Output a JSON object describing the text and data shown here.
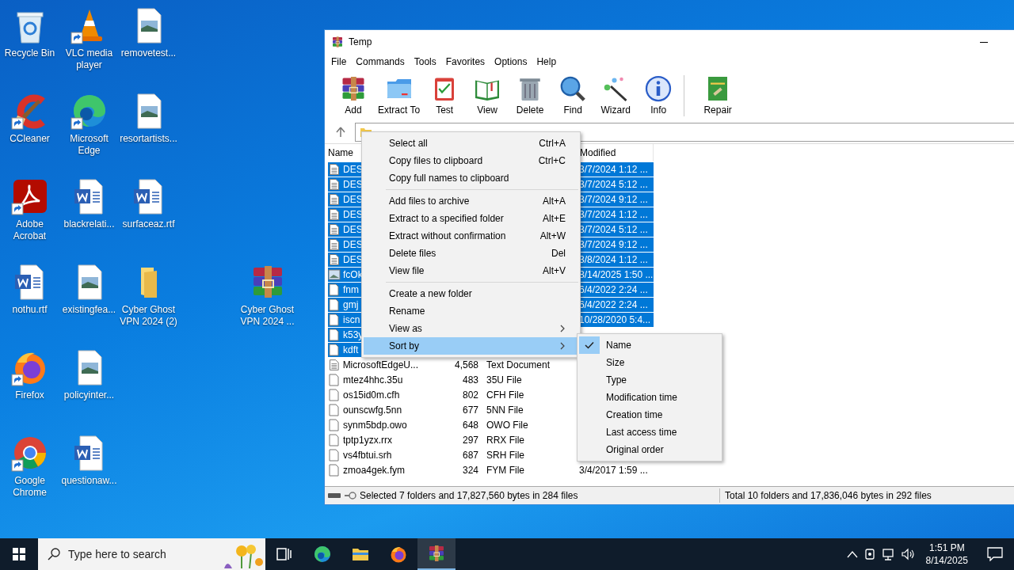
{
  "desktop_icons": [
    {
      "label": "Recycle Bin",
      "kind": "recycle",
      "shortcut": false
    },
    {
      "label": "CCleaner",
      "kind": "ccleaner",
      "shortcut": true
    },
    {
      "label": "Adobe Acrobat",
      "kind": "pdf",
      "shortcut": true
    },
    {
      "label": "nothu.rtf",
      "kind": "word",
      "shortcut": false
    },
    {
      "label": "Firefox",
      "kind": "firefox",
      "shortcut": true
    },
    {
      "label": "Google Chrome",
      "kind": "chrome",
      "shortcut": true
    },
    {
      "label": "VLC media player",
      "kind": "vlc",
      "shortcut": true
    },
    {
      "label": "Microsoft Edge",
      "kind": "edge",
      "shortcut": true
    },
    {
      "label": "blackrelati...",
      "kind": "word",
      "shortcut": false
    },
    {
      "label": "existingfea...",
      "kind": "image",
      "shortcut": false
    },
    {
      "label": "policyinter...",
      "kind": "image",
      "shortcut": false
    },
    {
      "label": "questionaw...",
      "kind": "word",
      "shortcut": false
    },
    {
      "label": "removetest...",
      "kind": "image",
      "shortcut": false
    },
    {
      "label": "resortartists...",
      "kind": "image",
      "shortcut": false
    },
    {
      "label": "surfaceaz.rtf",
      "kind": "word",
      "shortcut": false
    },
    {
      "label": "Cyber Ghost VPN 2024 (2)",
      "kind": "folder",
      "shortcut": false
    },
    {
      "label": "Cyber Ghost VPN 2024 ...",
      "kind": "archive",
      "shortcut": false
    }
  ],
  "window": {
    "title": "Temp",
    "menu": [
      "File",
      "Commands",
      "Tools",
      "Favorites",
      "Options",
      "Help"
    ],
    "toolbar": [
      {
        "label": "Add",
        "kind": "add"
      },
      {
        "label": "Extract To",
        "kind": "extract"
      },
      {
        "label": "Test",
        "kind": "test"
      },
      {
        "label": "View",
        "kind": "view"
      },
      {
        "label": "Delete",
        "kind": "delete"
      },
      {
        "label": "Find",
        "kind": "find"
      },
      {
        "label": "Wizard",
        "kind": "wizard"
      },
      {
        "label": "Info",
        "kind": "info"
      },
      {
        "label": "Repair",
        "kind": "repair"
      }
    ],
    "header": {
      "name": "Name",
      "modified": "Modified"
    },
    "rows": [
      {
        "name": "DES",
        "modified": "3/7/2024 1:12 ...",
        "kind": "text",
        "selected": true
      },
      {
        "name": "DES",
        "modified": "3/7/2024 5:12 ...",
        "kind": "text",
        "selected": true
      },
      {
        "name": "DES",
        "modified": "3/7/2024 9:12 ...",
        "kind": "text",
        "selected": true
      },
      {
        "name": "DES",
        "modified": "3/7/2024 1:12 ...",
        "kind": "text",
        "selected": true
      },
      {
        "name": "DES",
        "modified": "3/7/2024 5:12 ...",
        "kind": "text",
        "selected": true
      },
      {
        "name": "DES",
        "modified": "3/7/2024 9:12 ...",
        "kind": "text",
        "selected": true
      },
      {
        "name": "DES",
        "modified": "3/8/2024 1:12 ...",
        "kind": "text",
        "selected": true
      },
      {
        "name": "fcOk",
        "modified": "8/14/2025 1:50 ...",
        "kind": "image",
        "selected": true
      },
      {
        "name": "fnm",
        "modified": "6/4/2022 2:24 ...",
        "kind": "file",
        "selected": true
      },
      {
        "name": "gmj",
        "modified": "6/4/2022 2:24 ...",
        "kind": "file",
        "selected": true
      },
      {
        "name": "iscn",
        "modified": "10/28/2020 5:4...",
        "kind": "file",
        "selected": true
      },
      {
        "name": "k53y",
        "kind": "file",
        "selected": true
      },
      {
        "name": "kdft",
        "kind": "file",
        "selected": true
      },
      {
        "name": "MicrosoftEdgeU...",
        "size": "4,568",
        "type": "Text Document",
        "kind": "text",
        "selected": false
      },
      {
        "name": "mtez4hhc.35u",
        "size": "483",
        "type": "35U File",
        "kind": "file",
        "selected": false
      },
      {
        "name": "os15id0m.cfh",
        "size": "802",
        "type": "CFH File",
        "kind": "file",
        "selected": false
      },
      {
        "name": "ounscwfg.5nn",
        "size": "677",
        "type": "5NN File",
        "kind": "file",
        "selected": false
      },
      {
        "name": "synm5bdp.owo",
        "size": "648",
        "type": "OWO File",
        "kind": "file",
        "selected": false
      },
      {
        "name": "tptp1yzx.rrx",
        "size": "297",
        "type": "RRX File",
        "kind": "file",
        "selected": false
      },
      {
        "name": "vs4fbtui.srh",
        "size": "687",
        "type": "SRH File",
        "kind": "file",
        "selected": false
      },
      {
        "name": "zmoa4gek.fym",
        "size": "324",
        "type": "FYM File",
        "modified": "3/4/2017 1:59 ...",
        "kind": "file",
        "selected": false
      }
    ],
    "status": {
      "selected": "Selected 7 folders and 17,827,560 bytes in 284 files",
      "total": "Total 10 folders and 17,836,046 bytes in 292 files"
    }
  },
  "context_menu": {
    "items": [
      {
        "kind": "item",
        "label": "Select all",
        "shortcut": "Ctrl+A",
        "submenu": false,
        "selected": false
      },
      {
        "kind": "item",
        "label": "Copy files to clipboard",
        "shortcut": "Ctrl+C",
        "submenu": false,
        "selected": false
      },
      {
        "kind": "item",
        "label": "Copy full names to clipboard",
        "submenu": false,
        "selected": false
      },
      {
        "kind": "separator"
      },
      {
        "kind": "item",
        "label": "Add files to archive",
        "shortcut": "Alt+A",
        "submenu": false,
        "selected": false
      },
      {
        "kind": "item",
        "label": "Extract to a specified folder",
        "shortcut": "Alt+E",
        "submenu": false,
        "selected": false
      },
      {
        "kind": "item",
        "label": "Extract without confirmation",
        "shortcut": "Alt+W",
        "submenu": false,
        "selected": false
      },
      {
        "kind": "item",
        "label": "Delete files",
        "shortcut": "Del",
        "submenu": false,
        "selected": false
      },
      {
        "kind": "item",
        "label": "View file",
        "shortcut": "Alt+V",
        "submenu": false,
        "selected": false
      },
      {
        "kind": "separator"
      },
      {
        "kind": "item",
        "label": "Create a new folder",
        "submenu": false,
        "selected": false
      },
      {
        "kind": "item",
        "label": "Rename",
        "submenu": false,
        "selected": false
      },
      {
        "kind": "item",
        "label": "View as",
        "submenu": true,
        "selected": false
      },
      {
        "kind": "item",
        "label": "Sort by",
        "submenu": true,
        "selected": true
      }
    ]
  },
  "sort_submenu": {
    "items": [
      {
        "label": "Name",
        "checked": true
      },
      {
        "label": "Size",
        "checked": false
      },
      {
        "label": "Type",
        "checked": false
      },
      {
        "label": "Modification time",
        "checked": false
      },
      {
        "label": "Creation time",
        "checked": false
      },
      {
        "label": "Last access time",
        "checked": false
      },
      {
        "label": "Original order",
        "checked": false
      }
    ]
  },
  "taskbar": {
    "search": {
      "placeholder": "Type here to search"
    },
    "apps": [
      {
        "kind": "taskview",
        "active": false
      },
      {
        "kind": "edge",
        "active": false
      },
      {
        "kind": "folder",
        "active": false
      },
      {
        "kind": "firefox",
        "active": false
      },
      {
        "kind": "archive",
        "active": true
      }
    ],
    "time": "1:51 PM",
    "date": "8/14/2025"
  }
}
